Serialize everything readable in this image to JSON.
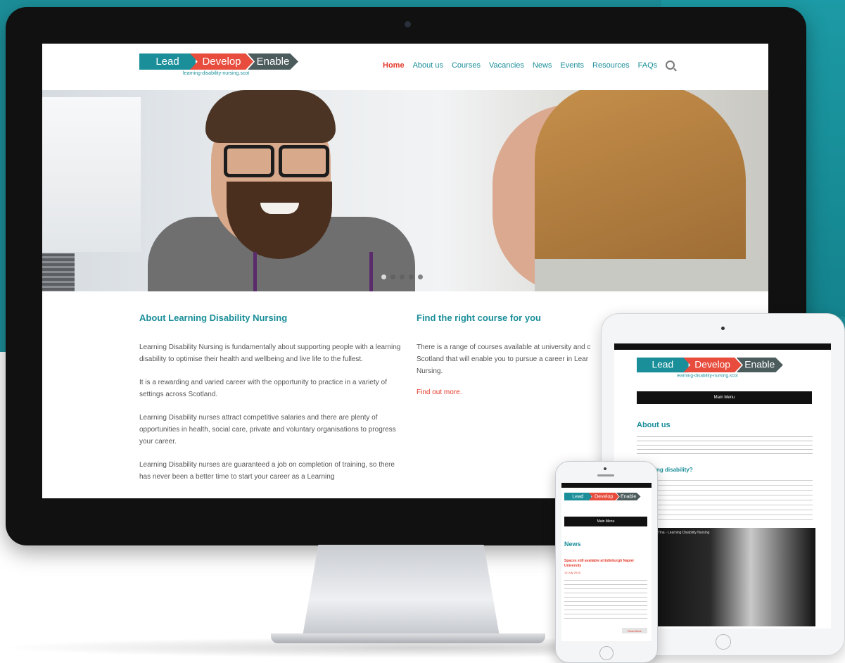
{
  "colors": {
    "teal": "#1a8e99",
    "red": "#e23a2a",
    "dark": "#4c5b5c",
    "background": "#1c8f99"
  },
  "logo": {
    "lead": "Lead",
    "develop": "Develop",
    "enable": "Enable",
    "url": "learning-disability-nursing.scot"
  },
  "nav": {
    "items": [
      "Home",
      "About us",
      "Courses",
      "Vacancies",
      "News",
      "Events",
      "Resources",
      "FAQs"
    ],
    "active": "Home",
    "search_icon": "search-icon"
  },
  "hero": {
    "slide_count": 5,
    "active_slide": 1
  },
  "about": {
    "title": "About Learning Disability Nursing",
    "paragraphs": [
      "Learning Disability Nursing is fundamentally about supporting people with a learning disability to optimise their health and wellbeing and live life to the fullest.",
      "It is a rewarding and varied career with the opportunity to practice in a variety of settings across Scotland.",
      "Learning Disability nurses attract competitive salaries and there are plenty of opportunities in health, social care, private and voluntary organisations to progress your career.",
      "Learning Disability nurses are guaranteed a job on completion of training, so there has never been a better time to start your career as a Learning"
    ]
  },
  "course": {
    "title": "Find the right course for you",
    "text": "There is a range of courses available at university and c Scotland that will enable you to pursue a career in Lear Nursing.",
    "link": "Find out more."
  },
  "ipad": {
    "menu_button": "Main Menu",
    "heading": "About us",
    "subheading": "a learning disability?",
    "video_title": "Tina - Learning Disability Nursing"
  },
  "iphone": {
    "menu_button": "Main Menu",
    "news_title": "News",
    "news_link": "Spaces still available at Edinburgh Napier University",
    "news_date": "13 July 2018",
    "read_more": "Read More"
  }
}
